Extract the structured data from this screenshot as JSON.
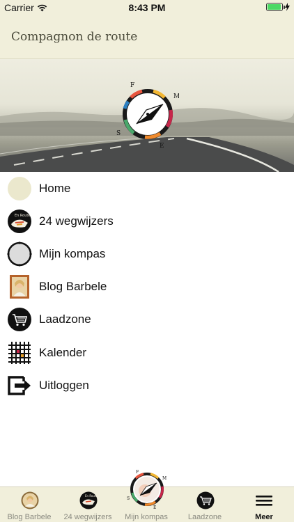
{
  "status_bar": {
    "carrier": "Carrier",
    "time": "8:43 PM",
    "battery_level": 0.95
  },
  "nav": {
    "title": "Compagnon de route"
  },
  "hero": {
    "compass_letters": [
      "F",
      "M",
      "E",
      "S"
    ]
  },
  "menu": {
    "items": [
      {
        "label": "Home",
        "icon": "home-circle-icon"
      },
      {
        "label": "24 wegwijzers",
        "icon": "wegwijzers-icon"
      },
      {
        "label": "Mijn kompas",
        "icon": "kompas-circle-icon"
      },
      {
        "label": "Blog Barbele",
        "icon": "portrait-icon"
      },
      {
        "label": "Laadzone",
        "icon": "cart-icon"
      },
      {
        "label": "Kalender",
        "icon": "calendar-grid-icon"
      },
      {
        "label": "Uitloggen",
        "icon": "logout-icon"
      }
    ]
  },
  "tabs": {
    "items": [
      {
        "label": "Blog Barbele",
        "icon": "portrait-icon"
      },
      {
        "label": "24 wegwijzers",
        "icon": "wegwijzers-icon"
      },
      {
        "label": "Mijn kompas",
        "icon": "compass-icon"
      },
      {
        "label": "Laadzone",
        "icon": "cart-icon"
      },
      {
        "label": "Meer",
        "icon": "hamburger-icon"
      }
    ],
    "active": "Meer"
  },
  "colors": {
    "bar_background": "#f1efdb",
    "active_tab": "#111111",
    "inactive_tab": "#8a8a80",
    "battery": "#4cd964"
  }
}
